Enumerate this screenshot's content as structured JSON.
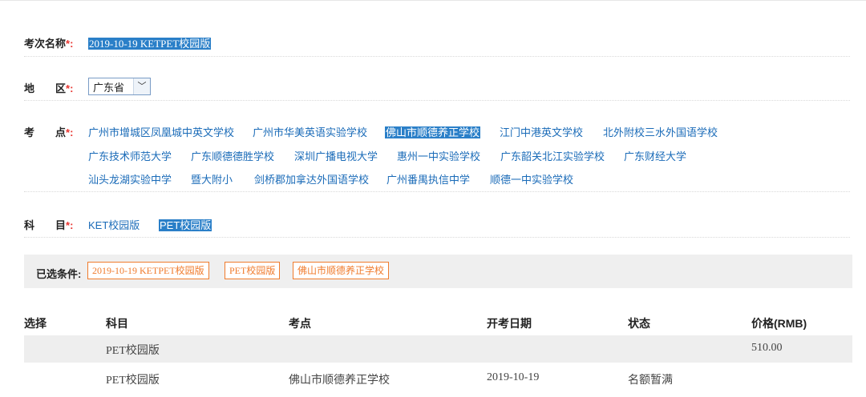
{
  "exam": {
    "label": "考次名称",
    "required_mark": "*:",
    "value": "2019-10-19 KETPET校园版"
  },
  "region": {
    "label": "地　　区",
    "required_mark": "*:",
    "selected": "广东省"
  },
  "site": {
    "label": "考　　点",
    "required_mark": "*:",
    "items": [
      "广州市增城区凤凰城中英文学校",
      "广州市华美英语实验学校",
      "佛山市顺德养正学校",
      "江门中港英文学校",
      "北外附校三水外国语学校",
      "广东技术师范大学",
      "广东顺德德胜学校",
      "深圳广播电视大学",
      "惠州一中实验学校",
      "广东韶关北江实验学校",
      "广东财经大学",
      "汕头龙湖实验中学",
      "暨大附小",
      "剑桥郡加拿达外国语学校",
      "广州番禺执信中学",
      "顺德一中实验学校"
    ],
    "selected_index": 2
  },
  "subject": {
    "label": "科　　目",
    "required_mark": "*:",
    "items": [
      "KET校园版",
      "PET校园版"
    ],
    "selected_index": 1
  },
  "conditions": {
    "label": "已选条件:",
    "tags": [
      "2019-10-19 KETPET校园版",
      "PET校园版",
      "佛山市顺德养正学校"
    ]
  },
  "table": {
    "headers": [
      "选择",
      "科目",
      "考点",
      "开考日期",
      "状态",
      "价格(RMB)"
    ],
    "rows": [
      [
        "",
        "PET校园版",
        "",
        "",
        "",
        "510.00"
      ],
      [
        "",
        "PET校园版",
        "佛山市顺德养正学校",
        "2019-10-19",
        "名额暂满",
        ""
      ]
    ]
  },
  "colors": {
    "link": "#1a6bb8",
    "highlight": "#2a7fc8",
    "required": "#e8312c",
    "tag": "#f07b2c"
  }
}
